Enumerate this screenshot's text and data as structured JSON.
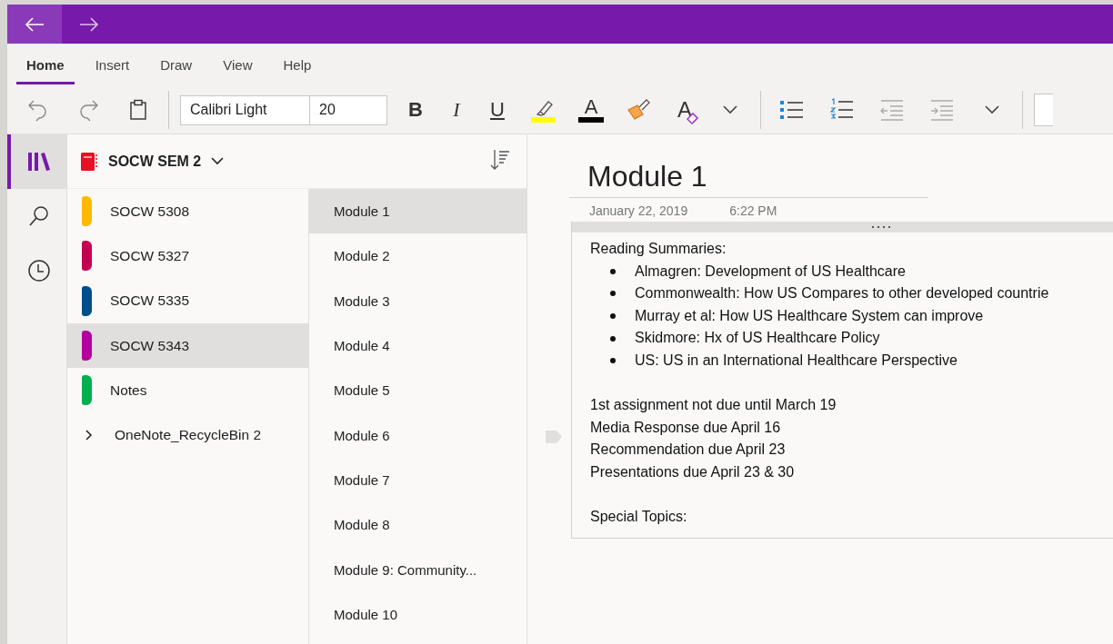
{
  "ribbon": {
    "tabs": [
      {
        "label": "Home",
        "selected": true
      },
      {
        "label": "Insert",
        "selected": false
      },
      {
        "label": "Draw",
        "selected": false
      },
      {
        "label": "View",
        "selected": false
      },
      {
        "label": "Help",
        "selected": false
      }
    ]
  },
  "toolbar": {
    "font": "Calibri Light",
    "size": "20",
    "bold": "B",
    "italic": "I",
    "underline": "U",
    "font_color": "A",
    "clear_format": "A"
  },
  "rail": [
    {
      "kind": "notebooks",
      "selected": true
    },
    {
      "kind": "search",
      "selected": false
    },
    {
      "kind": "recent",
      "selected": false
    }
  ],
  "notebook": {
    "title": "SOCW SEM 2"
  },
  "sections": [
    {
      "kind": "section",
      "label": "SOCW 5308",
      "color": "#ffb900",
      "selected": false
    },
    {
      "kind": "section",
      "label": "SOCW 5327",
      "color": "#c30052",
      "selected": false
    },
    {
      "kind": "section",
      "label": "SOCW 5335",
      "color": "#004e8c",
      "selected": false
    },
    {
      "kind": "section",
      "label": "SOCW 5343",
      "color": "#b4009e",
      "selected": true
    },
    {
      "kind": "section",
      "label": "Notes",
      "color": "#00b050",
      "selected": false
    },
    {
      "kind": "group",
      "label": "OneNote_RecycleBin 2",
      "selected": false
    }
  ],
  "pages": [
    {
      "label": "Module 1",
      "selected": true
    },
    {
      "label": "Module 2",
      "selected": false
    },
    {
      "label": "Module 3",
      "selected": false
    },
    {
      "label": "Module 4",
      "selected": false
    },
    {
      "label": "Module 5",
      "selected": false
    },
    {
      "label": "Module 6",
      "selected": false
    },
    {
      "label": "Module 7",
      "selected": false
    },
    {
      "label": "Module 8",
      "selected": false
    },
    {
      "label": "Module 9: Community...",
      "selected": false
    },
    {
      "label": "Module 10",
      "selected": false
    }
  ],
  "page": {
    "title": "Module 1",
    "date": "January 22, 2019",
    "time": "6:22 PM",
    "paragraphs": [
      [
        {
          "kind": "text",
          "text": "Reading Summaries:"
        },
        {
          "kind": "bullet",
          "text": "Almagren: Development of US Healthcare"
        },
        {
          "kind": "bullet",
          "text": "Commonwealth: How US Compares to other developed countrie"
        },
        {
          "kind": "bullet",
          "text": "Murray et al: How US Healthcare System can improve"
        },
        {
          "kind": "bullet",
          "text": "Skidmore: Hx of US Healthcare Policy"
        },
        {
          "kind": "bullet",
          "text": "US: US in an International Healthcare Perspective"
        }
      ],
      [
        {
          "kind": "text",
          "text": "1st assignment not due until March 19"
        },
        {
          "kind": "text",
          "text": "Media Response due April 16"
        },
        {
          "kind": "text",
          "text": "Recommendation due April 23"
        },
        {
          "kind": "text",
          "text": "Presentations due April 23 & 30"
        }
      ],
      [
        {
          "kind": "text",
          "text": "Special Topics:"
        }
      ]
    ]
  }
}
